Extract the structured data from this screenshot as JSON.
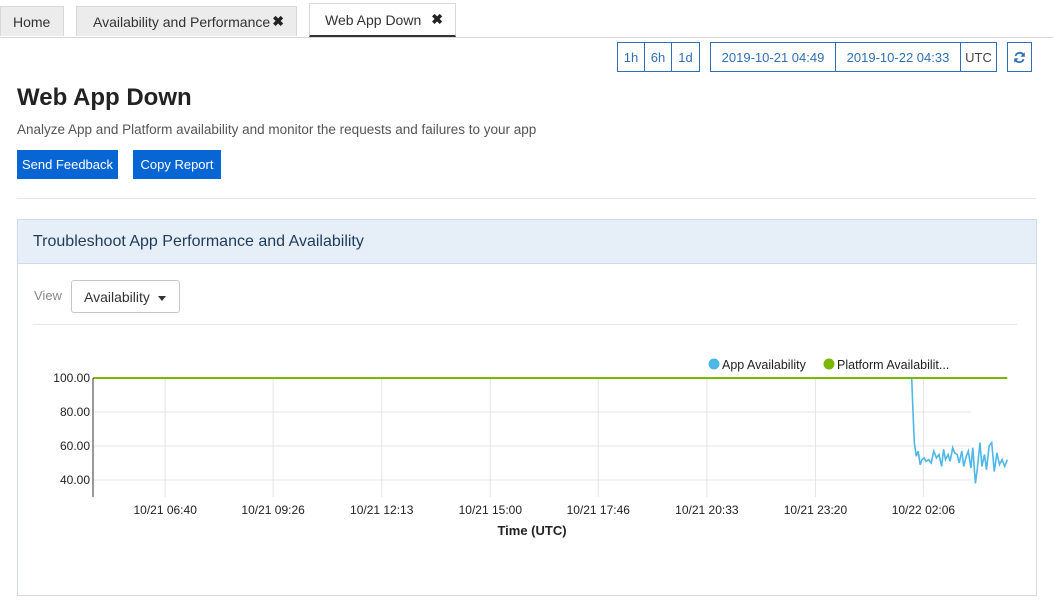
{
  "tabs": [
    {
      "label": "Home",
      "closable": false
    },
    {
      "label": "Availability and Performance",
      "closable": true
    },
    {
      "label": "Web App Down",
      "closable": true,
      "active": true
    }
  ],
  "time_range": {
    "quick": [
      "1h",
      "6h",
      "1d"
    ],
    "start": "2019-10-21 04:49",
    "end": "2019-10-22 04:33",
    "timezone": "UTC",
    "refresh_icon": "refresh-icon"
  },
  "page": {
    "title": "Web App Down",
    "description": "Analyze App and Platform availability and monitor the requests and failures to your app",
    "send_feedback": "Send Feedback",
    "copy_report": "Copy Report"
  },
  "panel": {
    "title": "Troubleshoot App Performance and Availability",
    "view_label": "View",
    "view_value": "Availability"
  },
  "colors": {
    "accent": "#0866d4",
    "app_series": "#4db7e8",
    "platform_series": "#7ab800"
  },
  "chart_data": {
    "type": "line",
    "xlabel": "Time (UTC)",
    "ylabel": "",
    "ylim": [
      30,
      100
    ],
    "yticks": [
      "100.00",
      "80.00",
      "60.00",
      "40.00"
    ],
    "x_tick_labels": [
      "10/21 06:40",
      "10/21 09:26",
      "10/21 12:13",
      "10/21 15:00",
      "10/21 17:46",
      "10/21 20:33",
      "10/21 23:20",
      "10/22 02:06"
    ],
    "x_range": [
      "2019-10-21 04:49",
      "2019-10-22 04:33"
    ],
    "grid": true,
    "legend": "top-right",
    "series": [
      {
        "name": "App Availability",
        "color": "#4db7e8",
        "points": [
          [
            "10/21 04:49",
            100
          ],
          [
            "10/22 01:48",
            100
          ],
          [
            "10/22 01:50",
            80
          ],
          [
            "10/22 01:52",
            62
          ],
          [
            "10/22 01:55",
            54
          ],
          [
            "10/22 01:58",
            57
          ],
          [
            "10/22 02:01",
            49
          ],
          [
            "10/22 02:04",
            52
          ],
          [
            "10/22 02:07",
            53
          ],
          [
            "10/22 02:10",
            51
          ],
          [
            "10/22 02:14",
            52
          ],
          [
            "10/22 02:18",
            50
          ],
          [
            "10/22 02:22",
            57
          ],
          [
            "10/22 02:26",
            53
          ],
          [
            "10/22 02:30",
            55
          ],
          [
            "10/22 02:34",
            48
          ],
          [
            "10/22 02:37",
            58
          ],
          [
            "10/22 02:40",
            52
          ],
          [
            "10/22 02:44",
            55
          ],
          [
            "10/22 02:47",
            51
          ],
          [
            "10/22 02:51",
            59
          ],
          [
            "10/22 02:54",
            56
          ],
          [
            "10/22 02:58",
            55
          ],
          [
            "10/22 03:01",
            50
          ],
          [
            "10/22 03:05",
            57
          ],
          [
            "10/22 03:08",
            48
          ],
          [
            "10/22 03:12",
            54
          ],
          [
            "10/22 03:15",
            57
          ],
          [
            "10/22 03:19",
            47
          ],
          [
            "10/22 03:22",
            59
          ],
          [
            "10/22 03:26",
            38
          ],
          [
            "10/22 03:29",
            47
          ],
          [
            "10/22 03:33",
            62
          ],
          [
            "10/22 03:36",
            48
          ],
          [
            "10/22 03:40",
            55
          ],
          [
            "10/22 03:43",
            46
          ],
          [
            "10/22 03:47",
            60
          ],
          [
            "10/22 03:51",
            62
          ],
          [
            "10/22 03:55",
            45
          ],
          [
            "10/22 03:59",
            56
          ],
          [
            "10/22 04:03",
            49
          ],
          [
            "10/22 04:07",
            52
          ],
          [
            "10/22 04:11",
            48
          ],
          [
            "10/22 04:15",
            52
          ]
        ]
      },
      {
        "name": "Platform Availabilit...",
        "color": "#7ab800",
        "points": [
          [
            "10/21 04:49",
            100
          ],
          [
            "10/22 04:15",
            100
          ]
        ]
      }
    ]
  }
}
